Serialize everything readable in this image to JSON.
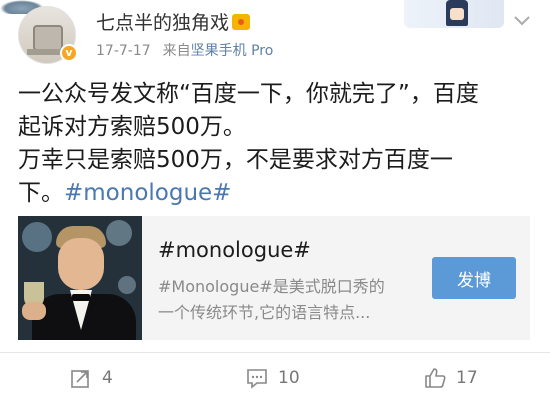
{
  "header": {
    "username": "七点半的独角戏",
    "verified_mark": "v",
    "date": "17-7-17",
    "source_prefix": "来自",
    "source": "坚果手机 Pro"
  },
  "post": {
    "lines": [
      "一公众号发文称“百度一下，你就完了”，百度",
      "起诉对方索赔500万。",
      "万幸只是索赔500万，不是要求对方百度一"
    ],
    "last_line_prefix": "下。",
    "hashtag": "#monologue#"
  },
  "card": {
    "title": "#monologue#",
    "desc_line1": "#Monologue#是美式脱口秀的",
    "desc_line2": "一个传统环节,它的语言特点...",
    "button_label": "发博"
  },
  "actions": {
    "repost_count": "4",
    "comment_count": "10",
    "like_count": "17"
  },
  "colors": {
    "link": "#4a78b0",
    "source": "#5f80a8",
    "button_bg": "#5b9ad6",
    "verified_badge": "#f6a623"
  },
  "icons": [
    "repost-icon",
    "comment-icon",
    "like-icon",
    "chevron-down-icon",
    "verified-icon",
    "crown-icon"
  ]
}
